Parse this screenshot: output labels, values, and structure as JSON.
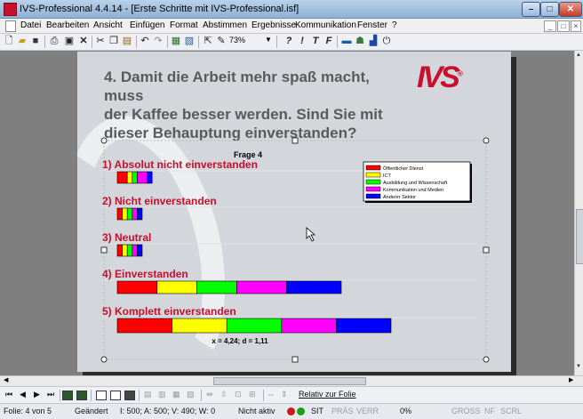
{
  "window": {
    "title": "IVS-Professional 4.4.14 - [Erste Schritte mit IVS-Professional.isf]",
    "controls": {
      "minimize": "–",
      "maximize": "□",
      "close": "✕"
    }
  },
  "menu": {
    "items": [
      "Datei",
      "Bearbeiten",
      "Ansicht",
      "Einfügen",
      "Format",
      "Abstimmen",
      "Ergebnisse",
      "Kommunikation",
      "Fenster",
      "?"
    ],
    "mdi_controls": [
      "_",
      "□",
      "×"
    ]
  },
  "toolbar": {
    "zoom": "73%",
    "format_labels": [
      "?",
      "!",
      "T",
      "F"
    ]
  },
  "slide": {
    "heading_lines": [
      "4. Damit die Arbeit mehr spaß macht, muss",
      "der Kaffee besser werden. Sind Sie mit",
      "dieser Behauptung einverstanden?"
    ],
    "logo": "IVS",
    "logo_mark": "®"
  },
  "chart_data": {
    "type": "bar",
    "title": "Frage 4",
    "orientation": "horizontal-stacked",
    "categories": [
      "1) Absolut nicht einverstanden",
      "2) Nicht einverstanden",
      "3) Neutral",
      "4) Einverstanden",
      "5) Komplett einverstanden"
    ],
    "series": [
      {
        "name": "Öffentlicher Dienst",
        "color": "#ff0000",
        "values": [
          2,
          1,
          1,
          8,
          11
        ]
      },
      {
        "name": "ICT",
        "color": "#ffff00",
        "values": [
          1,
          1,
          1,
          8,
          11
        ]
      },
      {
        "name": "Ausbildung und Wissenschaft",
        "color": "#00ff00",
        "values": [
          1,
          1,
          1,
          8,
          11
        ]
      },
      {
        "name": "Kommunikation und Medien",
        "color": "#ff00ff",
        "values": [
          2,
          1,
          1,
          10,
          11
        ]
      },
      {
        "name": "Anderer Sektor",
        "color": "#0000ff",
        "values": [
          1,
          1,
          1,
          11,
          11
        ]
      }
    ],
    "stats_label": "x = 4,24; d = 1,11"
  },
  "navbar": {
    "relative_label": "Relativ zur Folie"
  },
  "status": {
    "slide": "Folie: 4 von 5",
    "changed": "Geändert",
    "counts": "I: 500;  A: 500;  V: 490;  W: 0",
    "inactive": "Nicht aktiv",
    "sit": "SIT",
    "pras": "PRÄS",
    "verr": "VERR",
    "percent": "0%",
    "gross": "GROSS",
    "nf": "NF",
    "scrl": "SCRL"
  }
}
